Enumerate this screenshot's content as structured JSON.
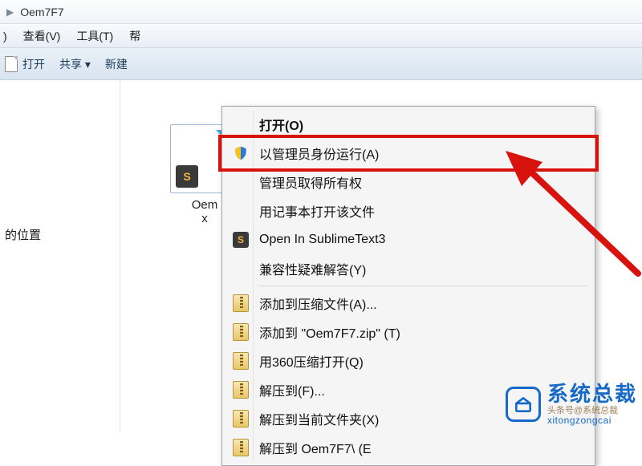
{
  "address": {
    "folder": "Oem7F7"
  },
  "menubar": {
    "view": "查看(V)",
    "tools": "工具(T)",
    "help_clip": "帮",
    "first_clip": ")"
  },
  "toolbar": {
    "open": "打开",
    "share": "共享 ▾",
    "new_clip": "新建"
  },
  "sidebar": {
    "location_clip": "的位置"
  },
  "file": {
    "name_clip": "Oem",
    "ext_clip": "x"
  },
  "context_menu": {
    "open": "打开(O)",
    "run_admin": "以管理员身份运行(A)",
    "take_ownership": "管理员取得所有权",
    "open_notepad": "用记事本打开该文件",
    "open_sublime": "Open In SublimeText3",
    "troubleshoot": "兼容性疑难解答(Y)",
    "add_archive": "添加到压缩文件(A)...",
    "add_zip": "添加到 \"Oem7F7.zip\" (T)",
    "open_360": "用360压缩打开(Q)",
    "extract_to": "解压到(F)...",
    "extract_here": "解压到当前文件夹(X)",
    "extract_folder_clip": "解压到 Oem7F7\\ (E"
  },
  "watermark": {
    "cn": "系统总裁",
    "sub": "头条号@系统总裁",
    "en": "xitongzongcai"
  }
}
